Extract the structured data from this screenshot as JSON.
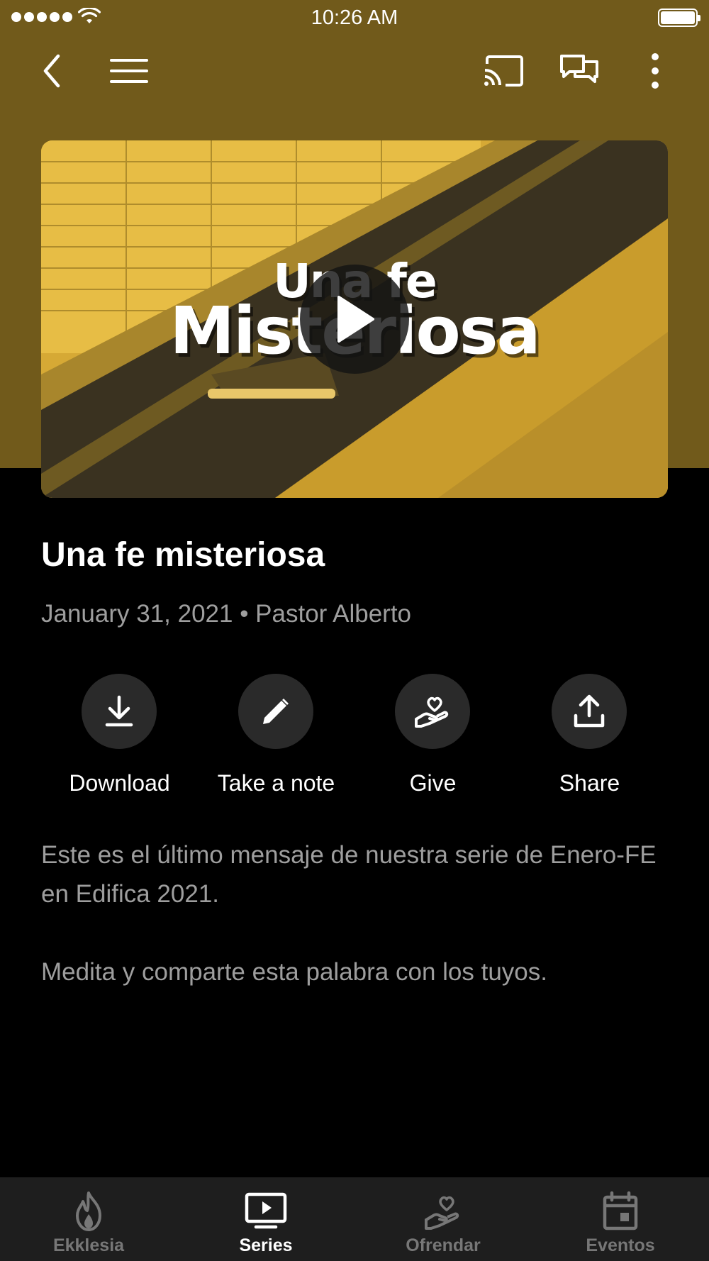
{
  "status_bar": {
    "time": "10:26 AM"
  },
  "toolbar": {
    "icons": [
      "back-arrow-icon",
      "menu-icon",
      "cast-icon",
      "chat-icon",
      "more-vertical-icon"
    ]
  },
  "video": {
    "title_line1": "Una fe",
    "title_line2": "Misteriosa",
    "theme_color": "#d6a935"
  },
  "sermon": {
    "title": "Una fe misteriosa",
    "meta": "January 31, 2021 • Pastor Alberto"
  },
  "actions": [
    {
      "label": "Download",
      "icon": "download-icon"
    },
    {
      "label": "Take a note",
      "icon": "pencil-icon"
    },
    {
      "label": "Give",
      "icon": "heart-hand-icon"
    },
    {
      "label": "Share",
      "icon": "share-icon"
    }
  ],
  "description": {
    "paragraph1": "Este es el último mensaje de nuestra serie de Enero-FE en Edifica 2021.",
    "paragraph2": "Medita y comparte esta palabra con los tuyos."
  },
  "tabbar": {
    "active": "Series",
    "tabs": [
      {
        "label": "Ekklesia",
        "icon": "flame-icon"
      },
      {
        "label": "Series",
        "icon": "tv-play-icon"
      },
      {
        "label": "Ofrendar",
        "icon": "heart-hand-icon"
      },
      {
        "label": "Eventos",
        "icon": "calendar-icon"
      }
    ]
  },
  "colors": {
    "header": "#715a1b",
    "background": "#000000",
    "tabbar": "#1e1e1e",
    "action_circle": "#2a2a2a"
  }
}
